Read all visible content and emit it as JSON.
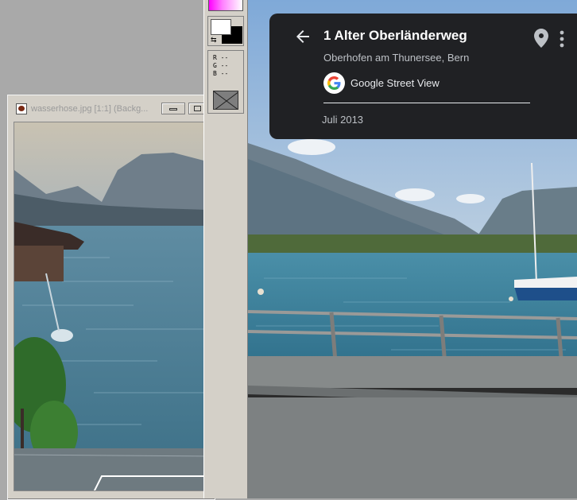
{
  "image_window": {
    "title": "wasserhose.jpg [1:1] (Backg...",
    "file_icon": "image-file-icon"
  },
  "palette": {
    "rgb": {
      "r_label": "R --",
      "g_label": "G --",
      "b_label": "B --"
    },
    "colors": {
      "foreground": "#ffffff",
      "background": "#000000",
      "gradient_start": "#ff00ff"
    }
  },
  "street_view": {
    "address": "1 Alter Oberländerweg",
    "locality": "Oberhofen am Thunersee, Bern",
    "source": "Google Street View",
    "date": "Juli 2013",
    "icons": [
      "back-arrow-icon",
      "google-logo-icon",
      "location-pin-icon",
      "more-vert-icon"
    ]
  }
}
